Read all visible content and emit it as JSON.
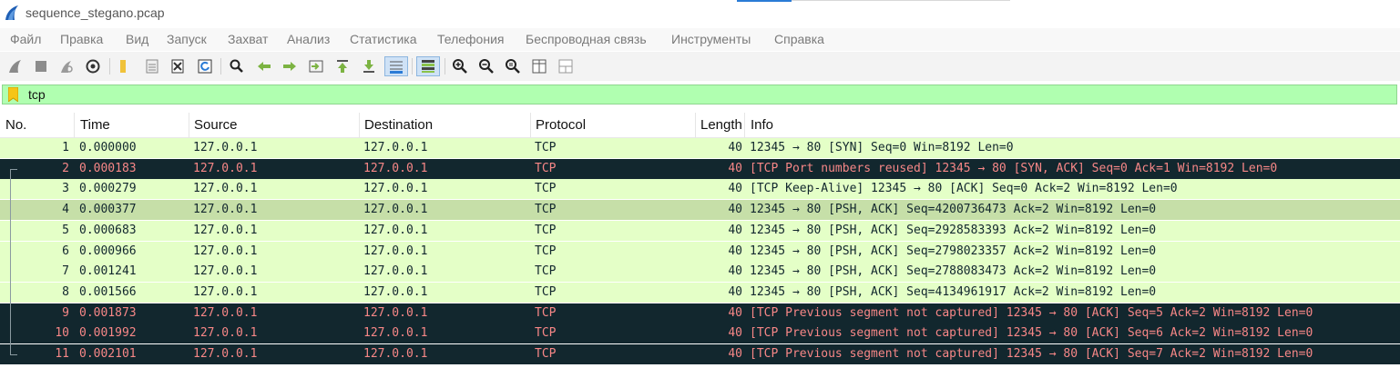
{
  "window": {
    "title": "sequence_stegano.pcap"
  },
  "menu": [
    "Файл",
    "Правка",
    "Вид",
    "Запуск",
    "Захват",
    "Анализ",
    "Статистика",
    "Телефония",
    "Беспроводная связь",
    "Инструменты",
    "Справка"
  ],
  "toolbar": {
    "icons": [
      "shark-fin-start-icon",
      "stop-square-icon",
      "restart-fin-icon",
      "capture-options-gear-icon",
      "open-folder-icon",
      "save-file-icon",
      "close-file-icon",
      "reload-icon",
      "find-magnifier-icon",
      "go-back-arrow-icon",
      "go-forward-arrow-icon",
      "go-to-packet-icon",
      "go-first-icon",
      "go-last-icon",
      "autoscroll-icon",
      "colorize-icon",
      "zoom-in-icon",
      "zoom-out-icon",
      "zoom-normal-icon",
      "resize-columns-icon",
      "layout-icon"
    ]
  },
  "filter": {
    "value": "tcp"
  },
  "columns": [
    "No.",
    "Time",
    "Source",
    "Destination",
    "Protocol",
    "Length",
    "Info"
  ],
  "colors": {
    "normal_bg": "#e4ffc7",
    "normal_fg": "#12272e",
    "selected_bg": "#c6dfa8",
    "bad_bg": "#12272e",
    "bad_fg": "#f78787",
    "filter_bg": "#b0ffb0",
    "accent": "#2a7bd6"
  },
  "packets": [
    {
      "no": "1",
      "time": "0.000000",
      "src": "127.0.0.1",
      "dst": "127.0.0.1",
      "proto": "TCP",
      "len": "40",
      "info": "12345 → 80 [SYN] Seq=0 Win=8192 Len=0",
      "style": "normal"
    },
    {
      "no": "2",
      "time": "0.000183",
      "src": "127.0.0.1",
      "dst": "127.0.0.1",
      "proto": "TCP",
      "len": "40",
      "info": "[TCP Port numbers reused] 12345 → 80 [SYN, ACK] Seq=0 Ack=1 Win=8192 Len=0",
      "style": "bad"
    },
    {
      "no": "3",
      "time": "0.000279",
      "src": "127.0.0.1",
      "dst": "127.0.0.1",
      "proto": "TCP",
      "len": "40",
      "info": "[TCP Keep-Alive] 12345 → 80 [ACK] Seq=0 Ack=2 Win=8192 Len=0",
      "style": "normal"
    },
    {
      "no": "4",
      "time": "0.000377",
      "src": "127.0.0.1",
      "dst": "127.0.0.1",
      "proto": "TCP",
      "len": "40",
      "info": "12345 → 80 [PSH, ACK] Seq=4200736473 Ack=2 Win=8192 Len=0",
      "style": "selected"
    },
    {
      "no": "5",
      "time": "0.000683",
      "src": "127.0.0.1",
      "dst": "127.0.0.1",
      "proto": "TCP",
      "len": "40",
      "info": "12345 → 80 [PSH, ACK] Seq=2928583393 Ack=2 Win=8192 Len=0",
      "style": "normal"
    },
    {
      "no": "6",
      "time": "0.000966",
      "src": "127.0.0.1",
      "dst": "127.0.0.1",
      "proto": "TCP",
      "len": "40",
      "info": "12345 → 80 [PSH, ACK] Seq=2798023357 Ack=2 Win=8192 Len=0",
      "style": "normal"
    },
    {
      "no": "7",
      "time": "0.001241",
      "src": "127.0.0.1",
      "dst": "127.0.0.1",
      "proto": "TCP",
      "len": "40",
      "info": "12345 → 80 [PSH, ACK] Seq=2788083473 Ack=2 Win=8192 Len=0",
      "style": "normal"
    },
    {
      "no": "8",
      "time": "0.001566",
      "src": "127.0.0.1",
      "dst": "127.0.0.1",
      "proto": "TCP",
      "len": "40",
      "info": "12345 → 80 [PSH, ACK] Seq=4134961917 Ack=2 Win=8192 Len=0",
      "style": "normal"
    },
    {
      "no": "9",
      "time": "0.001873",
      "src": "127.0.0.1",
      "dst": "127.0.0.1",
      "proto": "TCP",
      "len": "40",
      "info": "[TCP Previous segment not captured] 12345 → 80 [ACK] Seq=5 Ack=2 Win=8192 Len=0",
      "style": "bad"
    },
    {
      "no": "10",
      "time": "0.001992",
      "src": "127.0.0.1",
      "dst": "127.0.0.1",
      "proto": "TCP",
      "len": "40",
      "info": "[TCP Previous segment not captured] 12345 → 80 [ACK] Seq=6 Ack=2 Win=8192 Len=0",
      "style": "bad"
    },
    {
      "no": "11",
      "time": "0.002101",
      "src": "127.0.0.1",
      "dst": "127.0.0.1",
      "proto": "TCP",
      "len": "40",
      "info": "[TCP Previous segment not captured] 12345 → 80 [ACK] Seq=7 Ack=2 Win=8192 Len=0",
      "style": "bad"
    }
  ]
}
